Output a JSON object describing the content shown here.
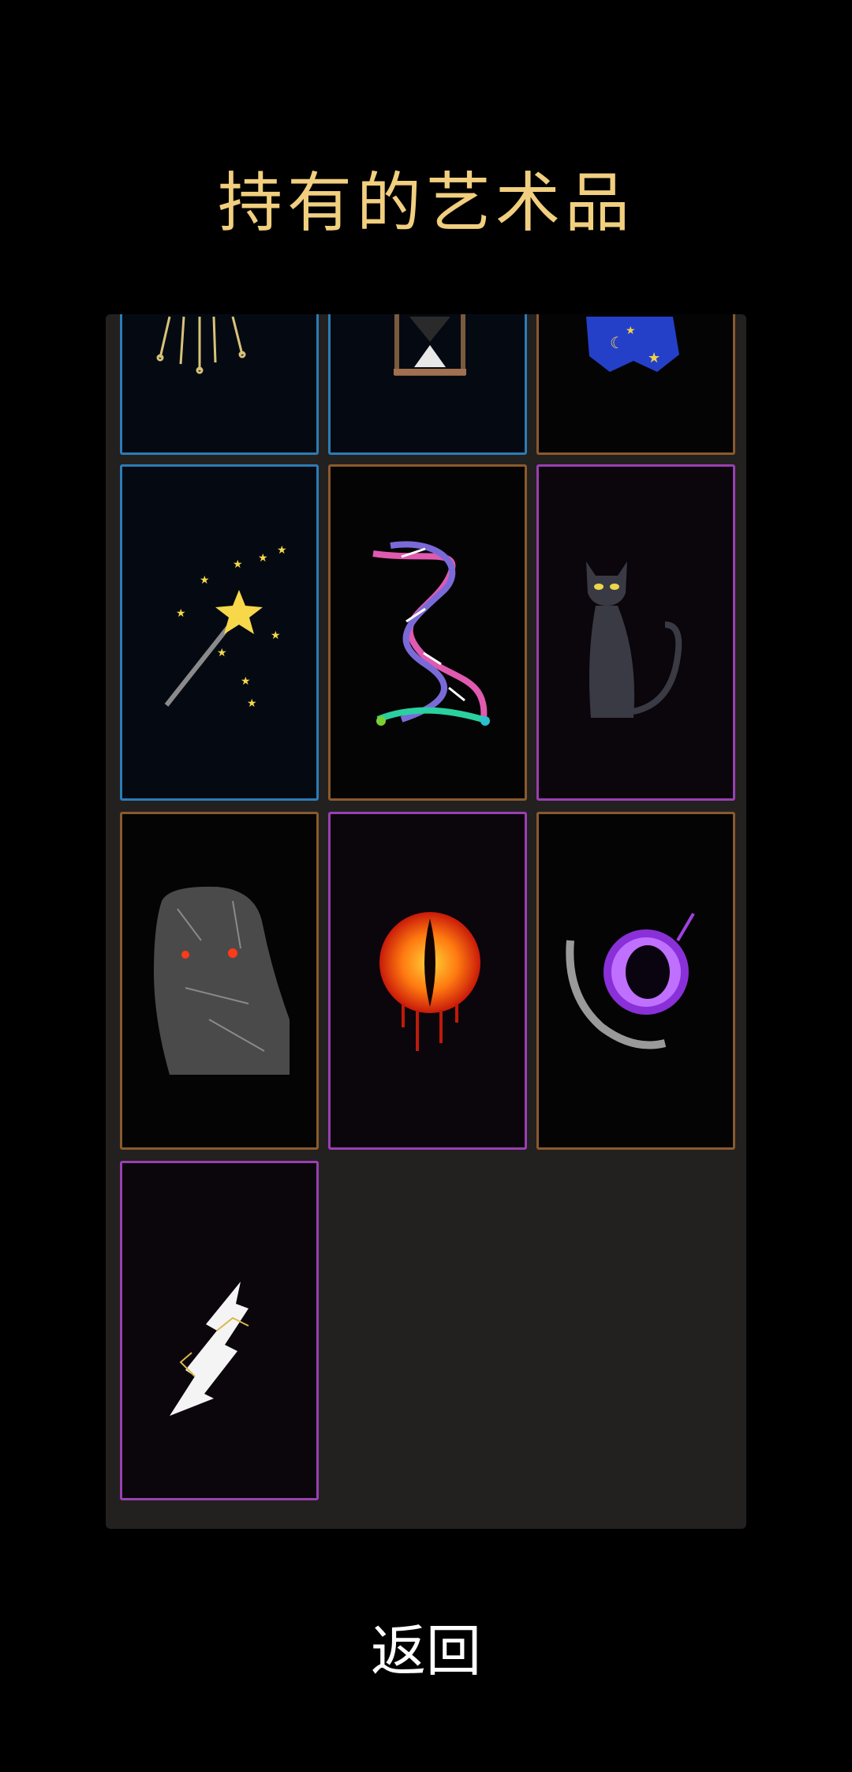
{
  "title": "持有的艺术品",
  "back_label": "返回",
  "cards": [
    {
      "art": "scrolls-icon",
      "frame": "blue"
    },
    {
      "art": "hourglass-icon",
      "frame": "blue"
    },
    {
      "art": "wizard-robe-icon",
      "frame": "orange"
    },
    {
      "art": "magic-wand-icon",
      "frame": "blue"
    },
    {
      "art": "dna-helix-icon",
      "frame": "orange"
    },
    {
      "art": "black-cat-icon",
      "frame": "purple"
    },
    {
      "art": "stone-golem-icon",
      "frame": "orange"
    },
    {
      "art": "fiery-eye-icon",
      "frame": "purple"
    },
    {
      "art": "void-portal-icon",
      "frame": "orange"
    },
    {
      "art": "lightning-crack-icon",
      "frame": "purple"
    }
  ]
}
